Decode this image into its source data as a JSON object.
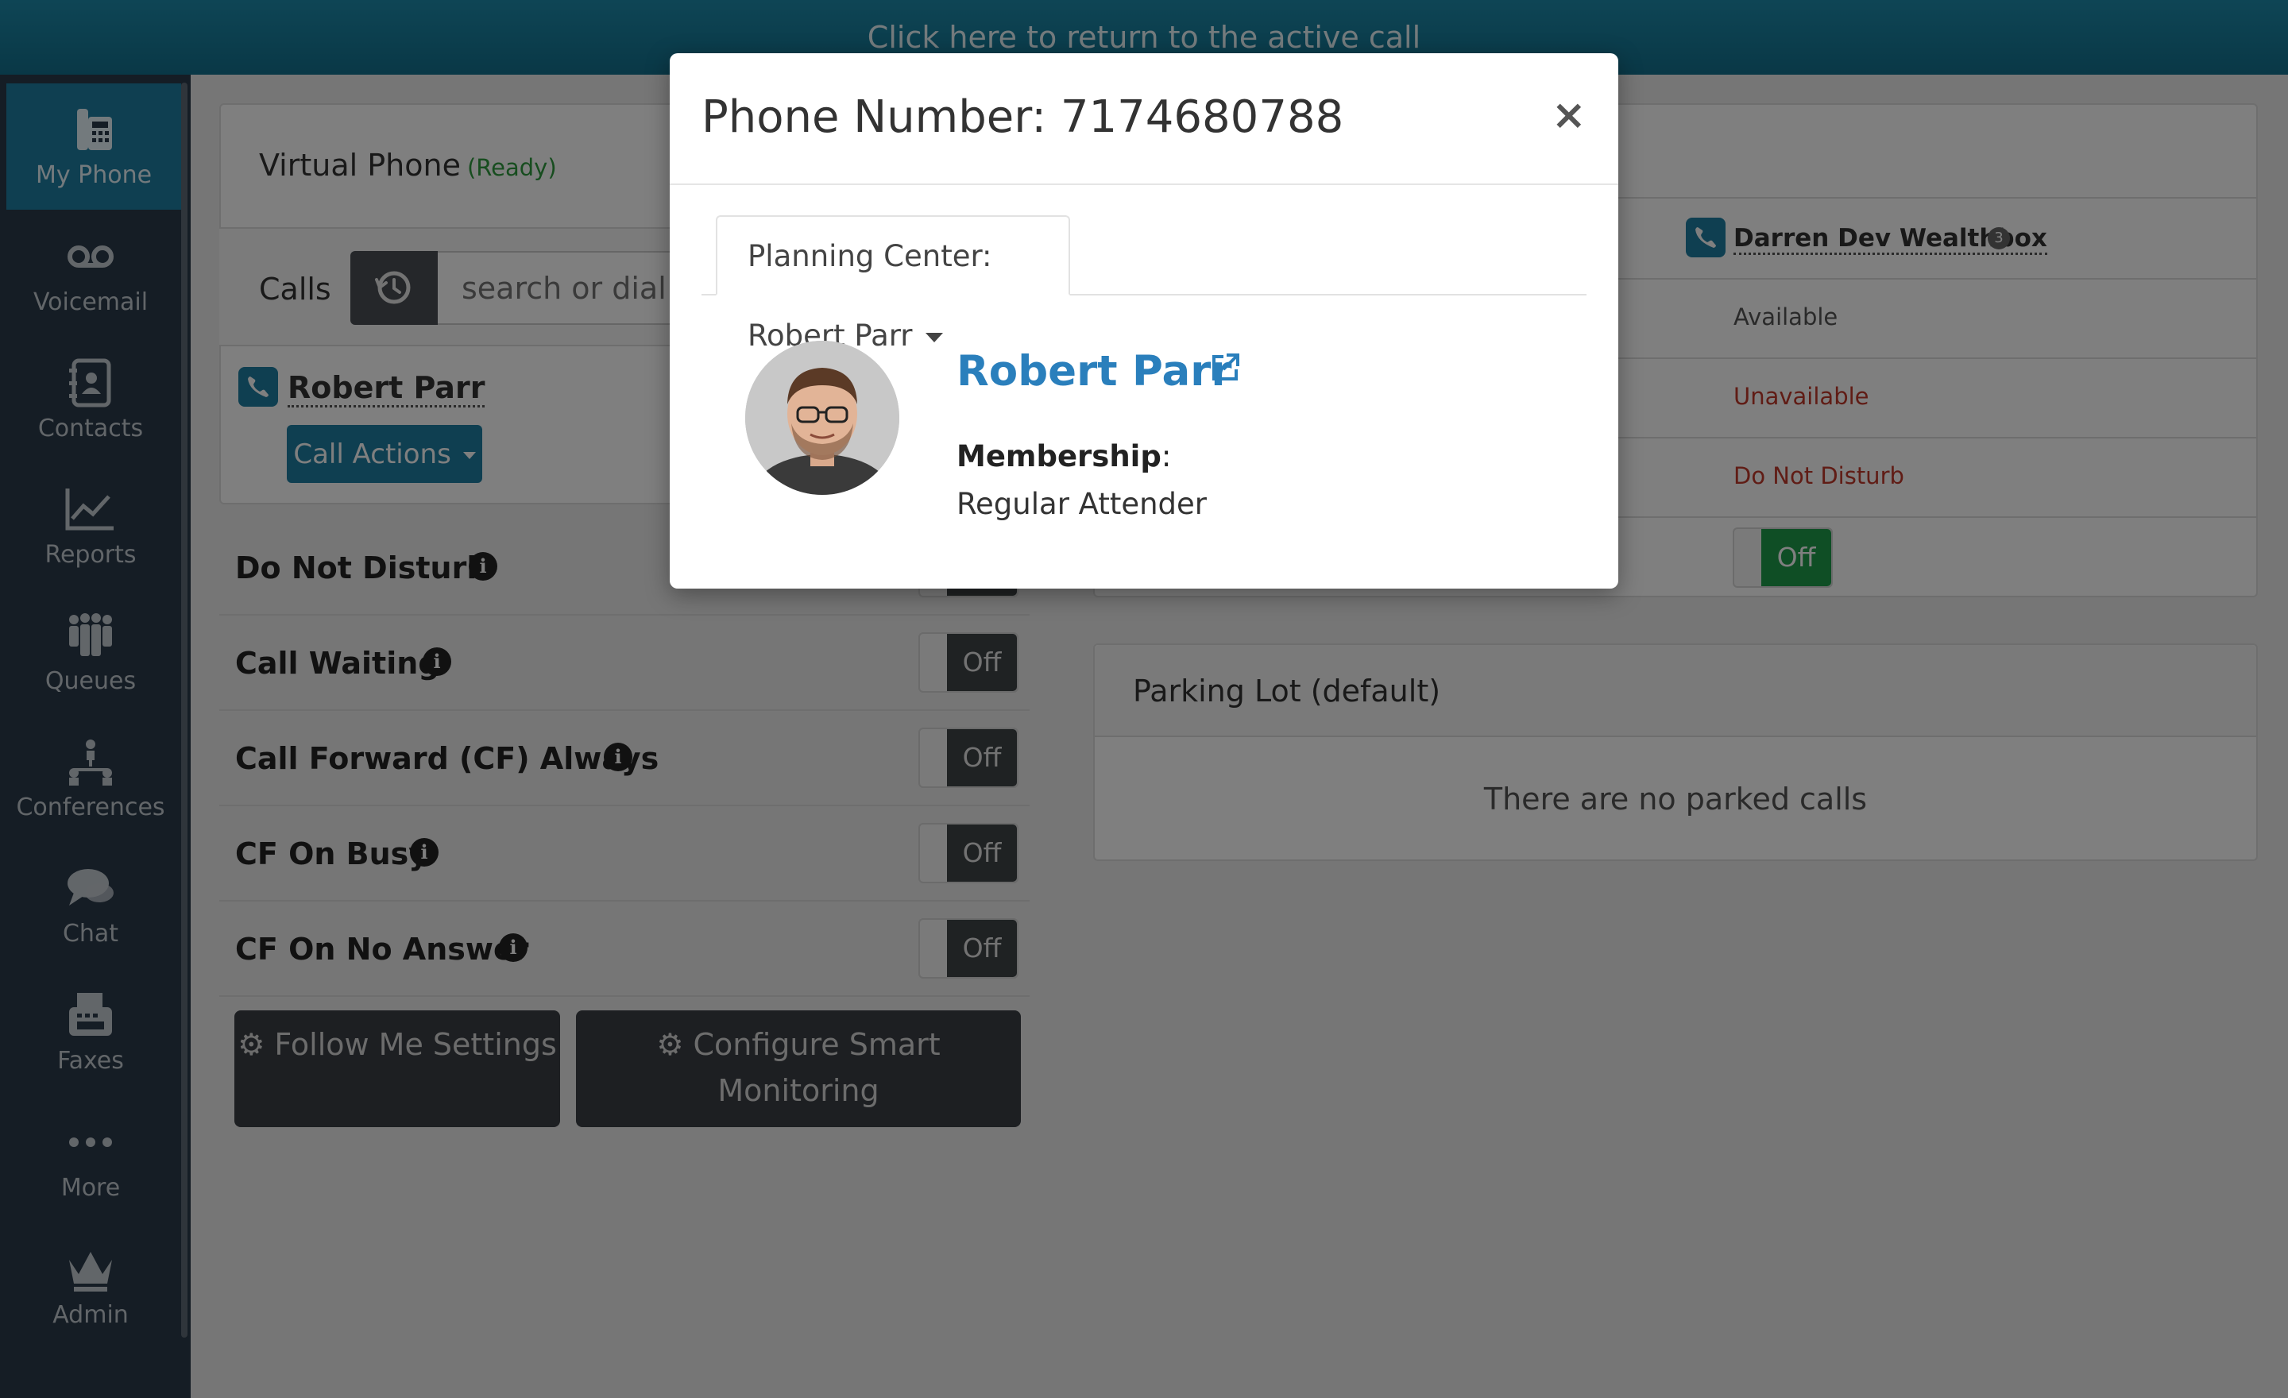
{
  "banner": {
    "text": "Click here to return to the active call"
  },
  "sidebar": {
    "items": [
      {
        "label": "My Phone",
        "icon": "phone-icon",
        "active": true
      },
      {
        "label": "Voicemail",
        "icon": "voicemail-icon"
      },
      {
        "label": "Contacts",
        "icon": "contacts-icon"
      },
      {
        "label": "Reports",
        "icon": "reports-icon"
      },
      {
        "label": "Queues",
        "icon": "queues-icon"
      },
      {
        "label": "Conferences",
        "icon": "conferences-icon"
      },
      {
        "label": "Chat",
        "icon": "chat-icon"
      },
      {
        "label": "Faxes",
        "icon": "fax-icon"
      },
      {
        "label": "More",
        "icon": "more-icon"
      },
      {
        "label": "Admin",
        "icon": "crown-icon"
      }
    ]
  },
  "phone_panel": {
    "title": "Virtual Phone",
    "status": "(Ready)",
    "calls_label": "Calls",
    "search_placeholder": "search or dial",
    "contact_name": "Robert Parr",
    "call_actions_label": "Call Actions"
  },
  "settings": [
    {
      "label": "Do Not Disturb",
      "value": "Off"
    },
    {
      "label": "Call Waiting",
      "value": "Off"
    },
    {
      "label": "Call Forward (CF) Always",
      "value": "Off"
    },
    {
      "label": "CF On Busy",
      "value": "Off"
    },
    {
      "label": "CF On No Answer",
      "value": "Off"
    }
  ],
  "buttons": {
    "follow_me": "Follow Me Settings",
    "smart_monitoring": "Configure Smart Monitoring"
  },
  "status_panel": {
    "user_name": "Darren Dev Wealthbox",
    "badge": "3",
    "statuses": [
      "Available",
      "Unavailable",
      "Do Not Disturb"
    ],
    "toggle_value": "Off"
  },
  "parking_lot": {
    "title": "Parking Lot (default)",
    "empty_text": "There are no parked calls"
  },
  "modal": {
    "title": "Phone Number: 7174680788",
    "close": "×",
    "tab_label": "Planning Center: Robert Parr",
    "person_name": "Robert Parr",
    "membership_label": "Membership",
    "membership_value": "Regular Attender"
  },
  "colors": {
    "accent": "#1e7fa3",
    "link": "#2a7fbc",
    "ready": "#2e9a3e",
    "danger": "#c0392b",
    "toggle_on": "#1f9d4a"
  }
}
